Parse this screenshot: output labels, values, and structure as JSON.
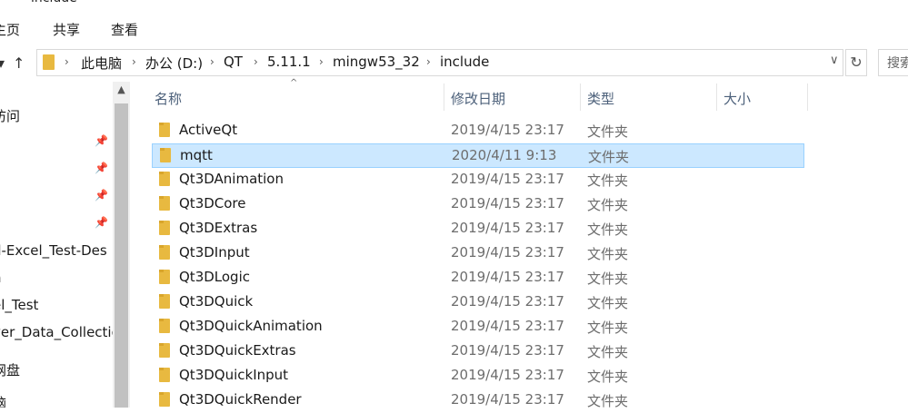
{
  "window": {
    "title": "include"
  },
  "ribbon": {
    "tabs": [
      "主页",
      "共享",
      "查看"
    ]
  },
  "nav_buttons": {
    "up": "↑"
  },
  "address": {
    "crumbs": [
      "此电脑",
      "办公 (D:)",
      "QT",
      "5.11.1",
      "mingw53_32",
      "include"
    ],
    "search_placeholder": "搜索"
  },
  "navpane": {
    "items": [
      {
        "label": "访问",
        "pinned": false
      },
      {
        "label": "",
        "pinned": true
      },
      {
        "label": "",
        "pinned": true
      },
      {
        "label": "",
        "pinned": true
      },
      {
        "label": "",
        "pinned": true
      },
      {
        "label": "d-Excel_Test-Des",
        "pinned": false
      },
      {
        "label": "n",
        "pinned": false
      },
      {
        "label": "el_Test",
        "pinned": false
      },
      {
        "label": "ver_Data_Collectio",
        "pinned": false
      },
      {
        "label": "网盘",
        "pinned": false
      },
      {
        "label": "脑",
        "pinned": false
      }
    ]
  },
  "columns": {
    "name": "名称",
    "modified": "修改日期",
    "type": "类型",
    "size": "大小"
  },
  "files": [
    {
      "name": "ActiveQt",
      "modified": "2019/4/15 23:17",
      "type": "文件夹",
      "selected": false
    },
    {
      "name": "mqtt",
      "modified": "2020/4/11 9:13",
      "type": "文件夹",
      "selected": true
    },
    {
      "name": "Qt3DAnimation",
      "modified": "2019/4/15 23:17",
      "type": "文件夹",
      "selected": false
    },
    {
      "name": "Qt3DCore",
      "modified": "2019/4/15 23:17",
      "type": "文件夹",
      "selected": false
    },
    {
      "name": "Qt3DExtras",
      "modified": "2019/4/15 23:17",
      "type": "文件夹",
      "selected": false
    },
    {
      "name": "Qt3DInput",
      "modified": "2019/4/15 23:17",
      "type": "文件夹",
      "selected": false
    },
    {
      "name": "Qt3DLogic",
      "modified": "2019/4/15 23:17",
      "type": "文件夹",
      "selected": false
    },
    {
      "name": "Qt3DQuick",
      "modified": "2019/4/15 23:17",
      "type": "文件夹",
      "selected": false
    },
    {
      "name": "Qt3DQuickAnimation",
      "modified": "2019/4/15 23:17",
      "type": "文件夹",
      "selected": false
    },
    {
      "name": "Qt3DQuickExtras",
      "modified": "2019/4/15 23:17",
      "type": "文件夹",
      "selected": false
    },
    {
      "name": "Qt3DQuickInput",
      "modified": "2019/4/15 23:17",
      "type": "文件夹",
      "selected": false
    },
    {
      "name": "Qt3DQuickRender",
      "modified": "2019/4/15 23:17",
      "type": "文件夹",
      "selected": false
    }
  ],
  "colors": {
    "selection_bg": "#cce8ff",
    "selection_border": "#99d1ff",
    "folder": "#e8b940",
    "header_text": "#4c607a"
  },
  "icons": {
    "folder": "folder-icon",
    "pin": "pin-icon",
    "refresh": "refresh-icon",
    "chevron": "chevron-right-icon"
  }
}
